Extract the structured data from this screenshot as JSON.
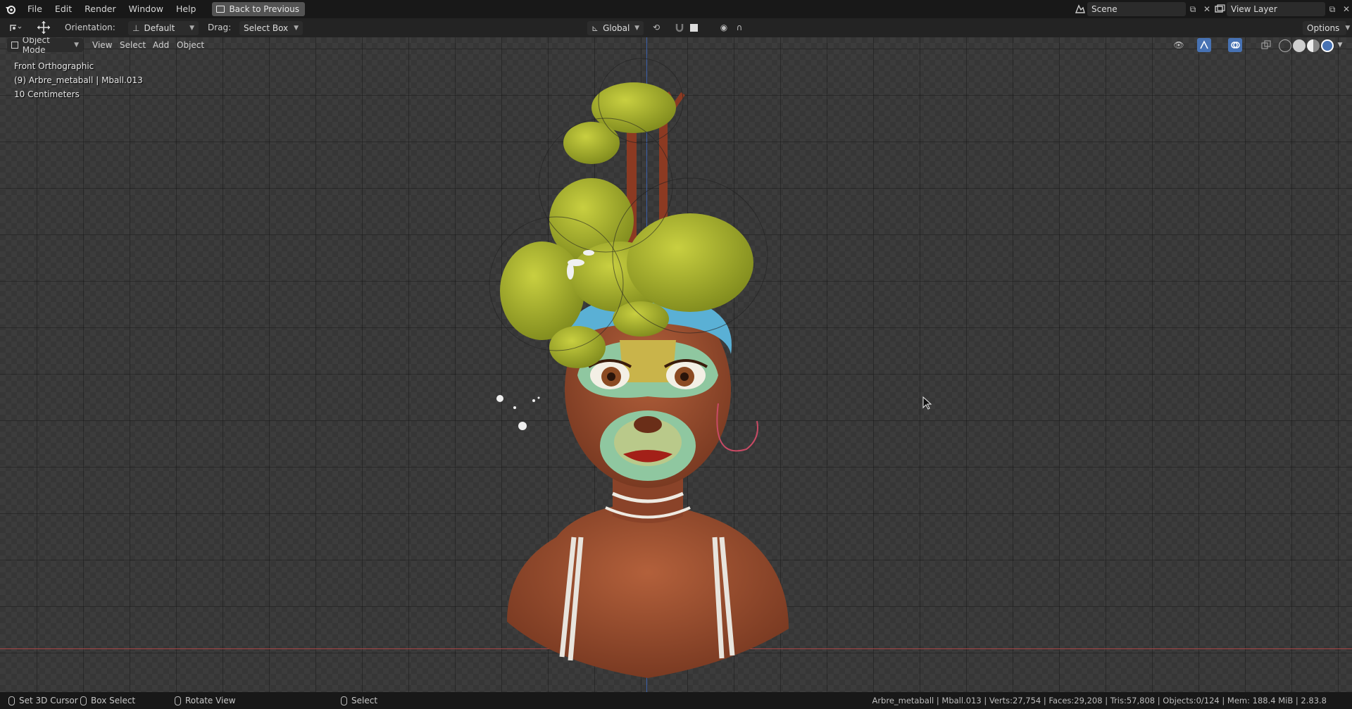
{
  "topbar": {
    "menus": [
      "File",
      "Edit",
      "Render",
      "Window",
      "Help"
    ],
    "back_button": "Back to Previous",
    "scene": "Scene",
    "view_layer": "View Layer"
  },
  "header": {
    "orientation_label": "Orientation:",
    "orientation_value": "Default",
    "drag_label": "Drag:",
    "drag_value": "Select Box",
    "transform_orientation": "Global",
    "options": "Options"
  },
  "viewport": {
    "mode": "Object Mode",
    "menus": [
      "View",
      "Select",
      "Add",
      "Object"
    ],
    "view_name": "Front Orthographic",
    "object_info": "(9) Arbre_metaball | Mball.013",
    "scale": "10 Centimeters"
  },
  "statusbar": {
    "left_click": "Set 3D Cursor",
    "drag": "Box Select",
    "middle": "Rotate View",
    "right": "Select",
    "stats": "Arbre_metaball | Mball.013 | Verts:27,754 | Faces:29,208 | Tris:57,808 | Objects:0/124 | Mem: 188.4 MiB | 2.83.8"
  },
  "colors": {
    "accent": "#4772b3",
    "skin": "#9a4f32",
    "hair": "#a8b030",
    "mask_teal": "#8fc7a0",
    "mask_yellow": "#c9b44a"
  }
}
